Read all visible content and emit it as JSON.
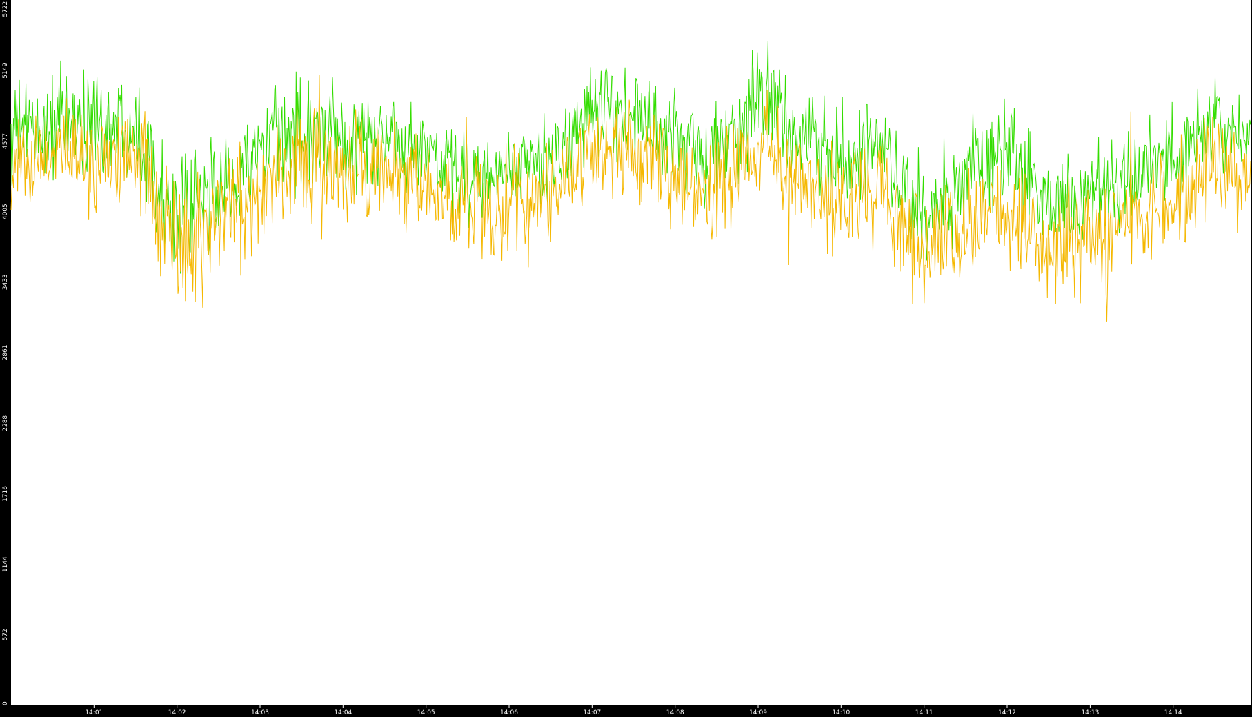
{
  "chart_data": {
    "type": "line",
    "title": "",
    "xlabel": "",
    "ylabel": "",
    "ylim": [
      0,
      5722
    ],
    "xlim": [
      "14:00:00",
      "14:14:56"
    ],
    "grid": false,
    "legend": "none",
    "y_ticks": [
      0,
      572,
      1144,
      1716,
      2288,
      2861,
      3433,
      4005,
      4577,
      5149,
      5722
    ],
    "x_ticks": [
      "14:01",
      "14:02",
      "14:03",
      "14:04",
      "14:05",
      "14:06",
      "14:07",
      "14:08",
      "14:09",
      "14:10",
      "14:11",
      "14:12",
      "14:13",
      "14:14"
    ],
    "colors": {
      "background": "#000000",
      "plot_background": "#ffffff",
      "tick_text": "#ffffff"
    },
    "series": [
      {
        "color": "#33dd00",
        "x": [
          "14:00:00",
          "14:00:30",
          "14:01:00",
          "14:01:30",
          "14:02:00",
          "14:02:30",
          "14:03:00",
          "14:03:30",
          "14:04:00",
          "14:04:30",
          "14:05:00",
          "14:05:30",
          "14:06:00",
          "14:06:30",
          "14:07:00",
          "14:07:30",
          "14:08:00",
          "14:08:30",
          "14:09:00",
          "14:09:30",
          "14:10:00",
          "14:10:30",
          "14:11:00",
          "14:11:30",
          "14:12:00",
          "14:12:30",
          "14:13:00",
          "14:13:30",
          "14:14:00",
          "14:14:30",
          "14:14:56"
        ],
        "mid": [
          4650,
          4700,
          4720,
          4730,
          3900,
          4200,
          4450,
          4680,
          4550,
          4620,
          4480,
          4280,
          4300,
          4440,
          4820,
          4760,
          4620,
          4450,
          4950,
          4680,
          4400,
          4540,
          3850,
          4320,
          4450,
          4080,
          4150,
          4300,
          4420,
          4750,
          4450
        ],
        "amp": [
          550,
          600,
          650,
          600,
          650,
          650,
          600,
          650,
          550,
          600,
          550,
          550,
          550,
          600,
          600,
          550,
          550,
          600,
          650,
          600,
          600,
          550,
          600,
          600,
          600,
          550,
          600,
          600,
          550,
          600,
          500
        ]
      },
      {
        "color": "#f5b800",
        "x": [
          "14:00:00",
          "14:00:30",
          "14:01:00",
          "14:01:30",
          "14:02:00",
          "14:02:30",
          "14:03:00",
          "14:03:30",
          "14:04:00",
          "14:04:30",
          "14:05:00",
          "14:05:30",
          "14:06:00",
          "14:06:30",
          "14:07:00",
          "14:07:30",
          "14:08:00",
          "14:08:30",
          "14:09:00",
          "14:09:30",
          "14:10:00",
          "14:10:30",
          "14:11:00",
          "14:11:30",
          "14:12:00",
          "14:12:30",
          "14:13:00",
          "14:13:30",
          "14:14:00",
          "14:14:30",
          "14:14:56"
        ],
        "mid": [
          4400,
          4450,
          4450,
          4500,
          3700,
          3950,
          4150,
          4350,
          4280,
          4350,
          4220,
          4050,
          4050,
          4180,
          4500,
          4480,
          4320,
          4100,
          4550,
          4250,
          4050,
          4180,
          3600,
          3950,
          4050,
          3700,
          3800,
          3950,
          4100,
          4450,
          4250
        ],
        "amp": [
          600,
          600,
          650,
          650,
          850,
          750,
          650,
          700,
          600,
          600,
          600,
          600,
          700,
          600,
          600,
          600,
          600,
          700,
          700,
          600,
          600,
          600,
          650,
          650,
          600,
          600,
          650,
          700,
          600,
          600,
          550
        ]
      }
    ]
  }
}
